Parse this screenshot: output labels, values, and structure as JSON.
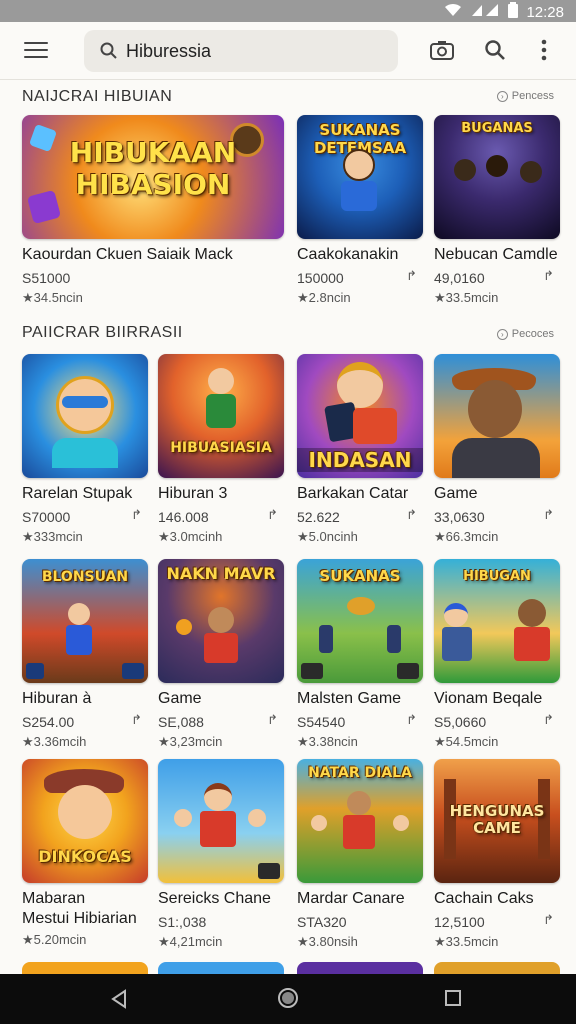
{
  "status": {
    "time": "12:28"
  },
  "search": {
    "value": "Hiburessia"
  },
  "sections": [
    {
      "title": "NAIJCRAI HIBUIAN",
      "more": "Pencess",
      "cards": [
        {
          "name": "Kaourdan Ckuen Saiaik Mack",
          "price": "S51000",
          "rating": "★34.5ncin",
          "art": "HIBUKAAN HIBASION",
          "bg": "#f08a1c",
          "bg2": "#7a2fb8"
        },
        {
          "name": "Caakokanakin",
          "price": "150000",
          "rating": "★2.8ncin",
          "art": "SUKANAS DETEMSAA",
          "bg": "#1d5fb8",
          "bg2": "#0b1c4a"
        },
        {
          "name": "Nebucan Camdle",
          "price": "49,0160",
          "rating": "★33.5mcin",
          "art": "BUGANAS",
          "bg": "#3b2a6e",
          "bg2": "#0e0a22"
        }
      ]
    },
    {
      "title": "PAIICRAR BIIRRASII",
      "more": "Pecoces",
      "cards": [
        {
          "name": "Rarelan Stupak",
          "price": "S70000",
          "rating": "★333mcin",
          "art": "",
          "bg": "#2a8fe0",
          "bg2": "#f2b11e"
        },
        {
          "name": "Hiburan 3",
          "price": "146.008",
          "rating": "★3.0mcinh",
          "art": "HIBUASIASIA",
          "bg": "#e2622b",
          "bg2": "#3a1450"
        },
        {
          "name": "Barkakan Catar",
          "price": "52.622",
          "rating": "★5.0ncinh",
          "art": "INDASAN",
          "bg": "#4b2fa0",
          "bg2": "#f58a1e"
        },
        {
          "name": "Game",
          "price": "33,0630",
          "rating": "★66.3mcin",
          "art": "",
          "bg": "#f3a23a",
          "bg2": "#2f8fd8"
        }
      ]
    },
    {
      "title": "",
      "more": "",
      "cards": [
        {
          "name": "Hiburan à",
          "price": "S254.00",
          "rating": "★3.36mcih",
          "art": "BLONSUAN",
          "bg": "#3d8fd1",
          "bg2": "#d04a2a"
        },
        {
          "name": "Game",
          "price": "SE,088",
          "rating": "★3,23mcin",
          "art": "NAKN MAVR",
          "bg": "#2b2b5a",
          "bg2": "#e1752a"
        },
        {
          "name": "Malsten Game",
          "price": "S54540",
          "rating": "★3.38ncin",
          "art": "SUKANAS",
          "bg": "#3aa3d8",
          "bg2": "#4a9a3a"
        },
        {
          "name": "Vionam Beqale",
          "price": "S5,0660",
          "rating": "★54.5mcin",
          "art": "HIBUGAN",
          "bg": "#35b0d8",
          "bg2": "#2f9a3a"
        }
      ]
    },
    {
      "title": "",
      "more": "",
      "cards": [
        {
          "name": "Mabaran",
          "name2": "Mestui Hibiarian",
          "price": "",
          "rating": "★5.20mcin",
          "art": "DINKOCAS",
          "bg": "#f2a31e",
          "bg2": "#c53b2a"
        },
        {
          "name": "Sereicks Chane",
          "price": "S1:,038",
          "rating": "★4,21mcin",
          "art": "",
          "bg": "#3f9fe8",
          "bg2": "#f2c03a"
        },
        {
          "name": "Mardar Canare",
          "price": "STA320",
          "rating": "★3.80nsih",
          "art": "NATAR DIALA",
          "bg": "#3a9a3a",
          "bg2": "#e0a02a"
        },
        {
          "name": "Cachain Caks",
          "price": "12,5100",
          "rating": "★33.5mcin",
          "art": "HENGUNAS CAME",
          "bg": "#c84f1e",
          "bg2": "#5a2410"
        }
      ]
    }
  ],
  "colors": {
    "accent_gold": "#ffd84a",
    "navbar": "#0c0c0c",
    "statusbar": "#9a9a9a"
  },
  "icons": [
    "menu-icon",
    "search-icon",
    "camera-icon",
    "more-vert-icon",
    "share-icon",
    "back-icon",
    "home-icon",
    "recents-icon"
  ]
}
